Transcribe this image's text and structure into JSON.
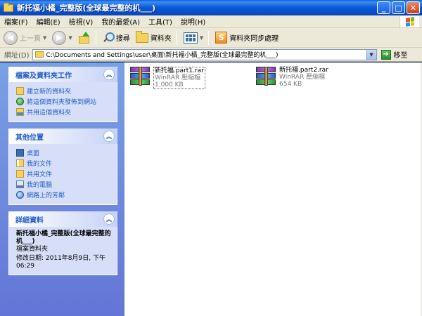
{
  "window": {
    "title": "新托福小橘_完整版(全球最完整的机___)"
  },
  "title_buttons": {
    "minimize": "_",
    "maximize": "□",
    "close": "✕"
  },
  "menu": [
    "檔案(F)",
    "編輯(E)",
    "檢視(V)",
    "我的最愛(A)",
    "工具(T)",
    "說明(H)"
  ],
  "toolbar": {
    "back_label": "上一頁",
    "search_label": "搜尋",
    "folders_label": "資料夾",
    "sync_label": "資料夾同步處理"
  },
  "address": {
    "label": "網址(D)",
    "path": "C:\\Documents and Settings\\user\\桌面\\新托福小橘_完整版(全球最完整的机___)",
    "go_label": "移至"
  },
  "panels": {
    "tasks": {
      "title": "檔案及資料夾工作",
      "items": [
        "建立新的資料夾",
        "將這個資料夾發佈到網站",
        "共用這個資料夾"
      ]
    },
    "places": {
      "title": "其他位置",
      "items": [
        "桌面",
        "我的文件",
        "共用文件",
        "我的電腦",
        "網路上的芳鄰"
      ]
    },
    "details": {
      "title": "詳細資料",
      "name": "新托福小橘_完整版(全球最完整的机___)",
      "type": "檔案資料夾",
      "modified": "修改日期: 2011年8月9日, 下午 06:29"
    }
  },
  "files": [
    {
      "name": "新托福.part1.rar",
      "type": "WinRAR 壓縮檔",
      "size": "1,000 KB",
      "selected": true
    },
    {
      "name": "新托福.part2.rar",
      "type": "WinRAR 壓縮檔",
      "size": "654 KB",
      "selected": false
    }
  ],
  "icons": {
    "folder": "folder-icon",
    "rar": "winrar-archive-icon",
    "winlogo": "windows-logo-icon"
  },
  "colors": {
    "titlebar": "#0b58d6",
    "taskpane": "#6f8ede",
    "link": "#215dc6",
    "chrome": "#ece9d8"
  }
}
